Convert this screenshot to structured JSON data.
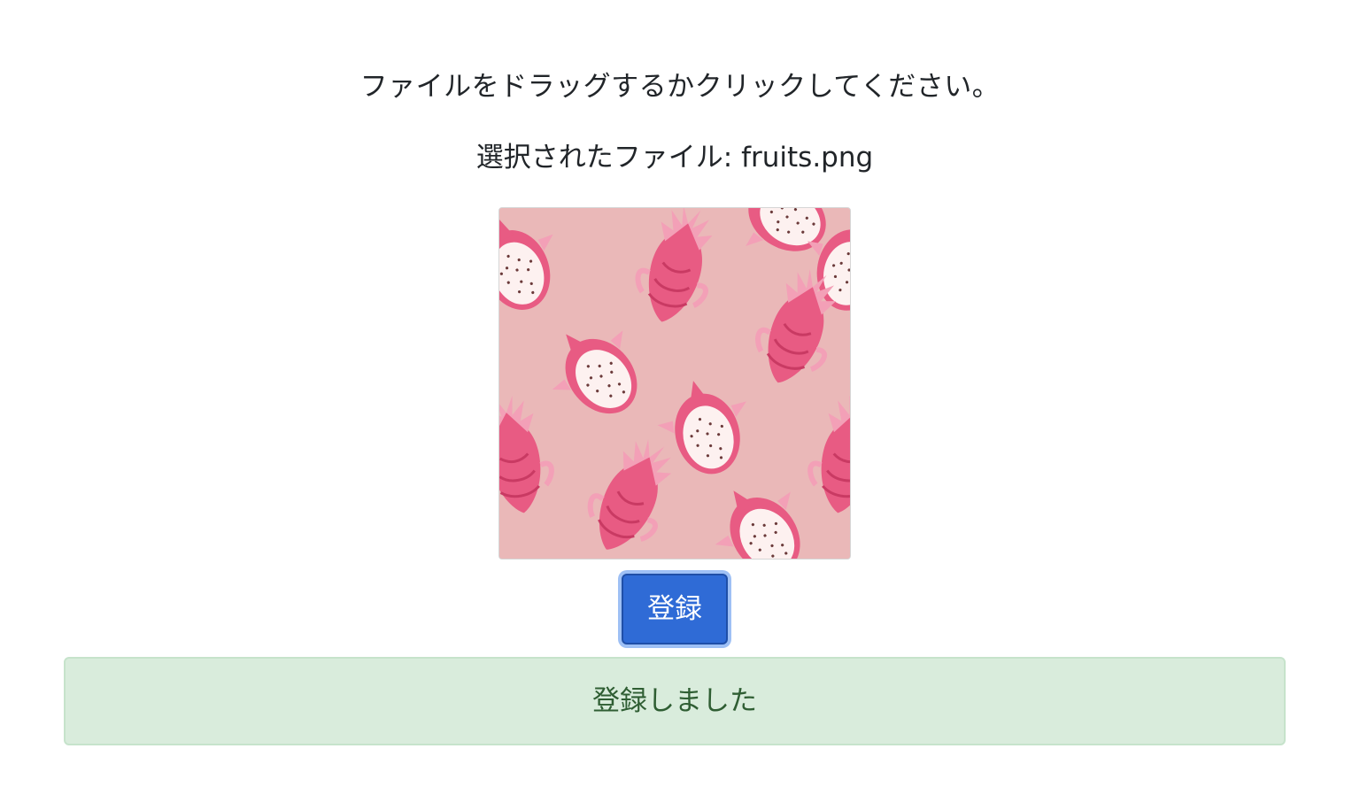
{
  "upload": {
    "instruction": "ファイルをドラッグするかクリックしてください。",
    "selected_file_label": "選択されたファイル: fruits.png"
  },
  "preview": {
    "image_description_icon": "dragon-fruit-pattern-image"
  },
  "actions": {
    "register_label": "登録"
  },
  "alert": {
    "message": "登録しました"
  },
  "colors": {
    "primary": "#2f6bd6",
    "success_bg": "#d9ecdc",
    "success_text": "#2f5e33",
    "preview_bg": "#eab8b8"
  }
}
